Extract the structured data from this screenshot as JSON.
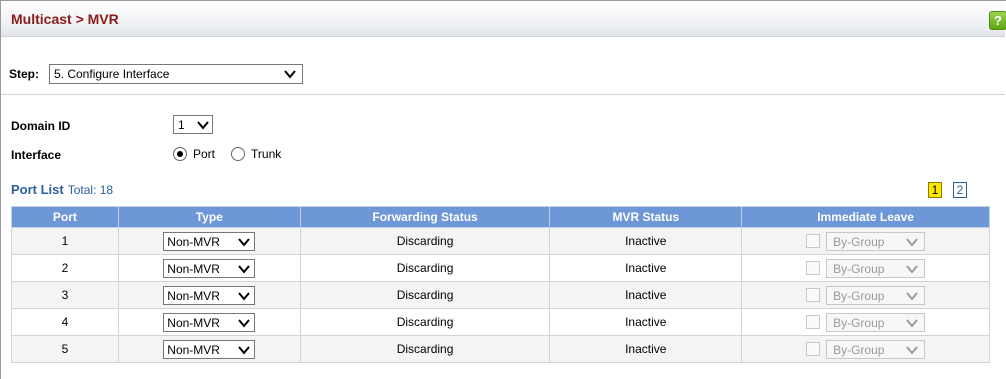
{
  "header": {
    "title": "Multicast > MVR",
    "help_label": "?"
  },
  "step": {
    "label": "Step:",
    "selected": "5. Configure Interface"
  },
  "form": {
    "domain_id_label": "Domain ID",
    "domain_id_value": "1",
    "interface_label": "Interface",
    "interface_options": [
      {
        "label": "Port",
        "selected": true
      },
      {
        "label": "Trunk",
        "selected": false
      }
    ]
  },
  "port_list": {
    "title": "Port List",
    "total": "Total: 18",
    "pages": [
      {
        "label": "1",
        "active": true
      },
      {
        "label": "2",
        "active": false
      }
    ],
    "columns": [
      "Port",
      "Type",
      "Forwarding Status",
      "MVR Status",
      "Immediate Leave"
    ],
    "rows": [
      {
        "port": "1",
        "type": "Non-MVR",
        "forwarding": "Discarding",
        "mvr_status": "Inactive",
        "leave_mode": "By-Group"
      },
      {
        "port": "2",
        "type": "Non-MVR",
        "forwarding": "Discarding",
        "mvr_status": "Inactive",
        "leave_mode": "By-Group"
      },
      {
        "port": "3",
        "type": "Non-MVR",
        "forwarding": "Discarding",
        "mvr_status": "Inactive",
        "leave_mode": "By-Group"
      },
      {
        "port": "4",
        "type": "Non-MVR",
        "forwarding": "Discarding",
        "mvr_status": "Inactive",
        "leave_mode": "By-Group"
      },
      {
        "port": "5",
        "type": "Non-MVR",
        "forwarding": "Discarding",
        "mvr_status": "Inactive",
        "leave_mode": "By-Group"
      }
    ]
  },
  "colors": {
    "title": "#8b1a1a",
    "table_header": "#6d97d6",
    "link": "#2b5f9e",
    "page_active": "#ffe600"
  },
  "icons": {
    "help": "help-icon",
    "dropdown": "chevron-down-icon"
  }
}
